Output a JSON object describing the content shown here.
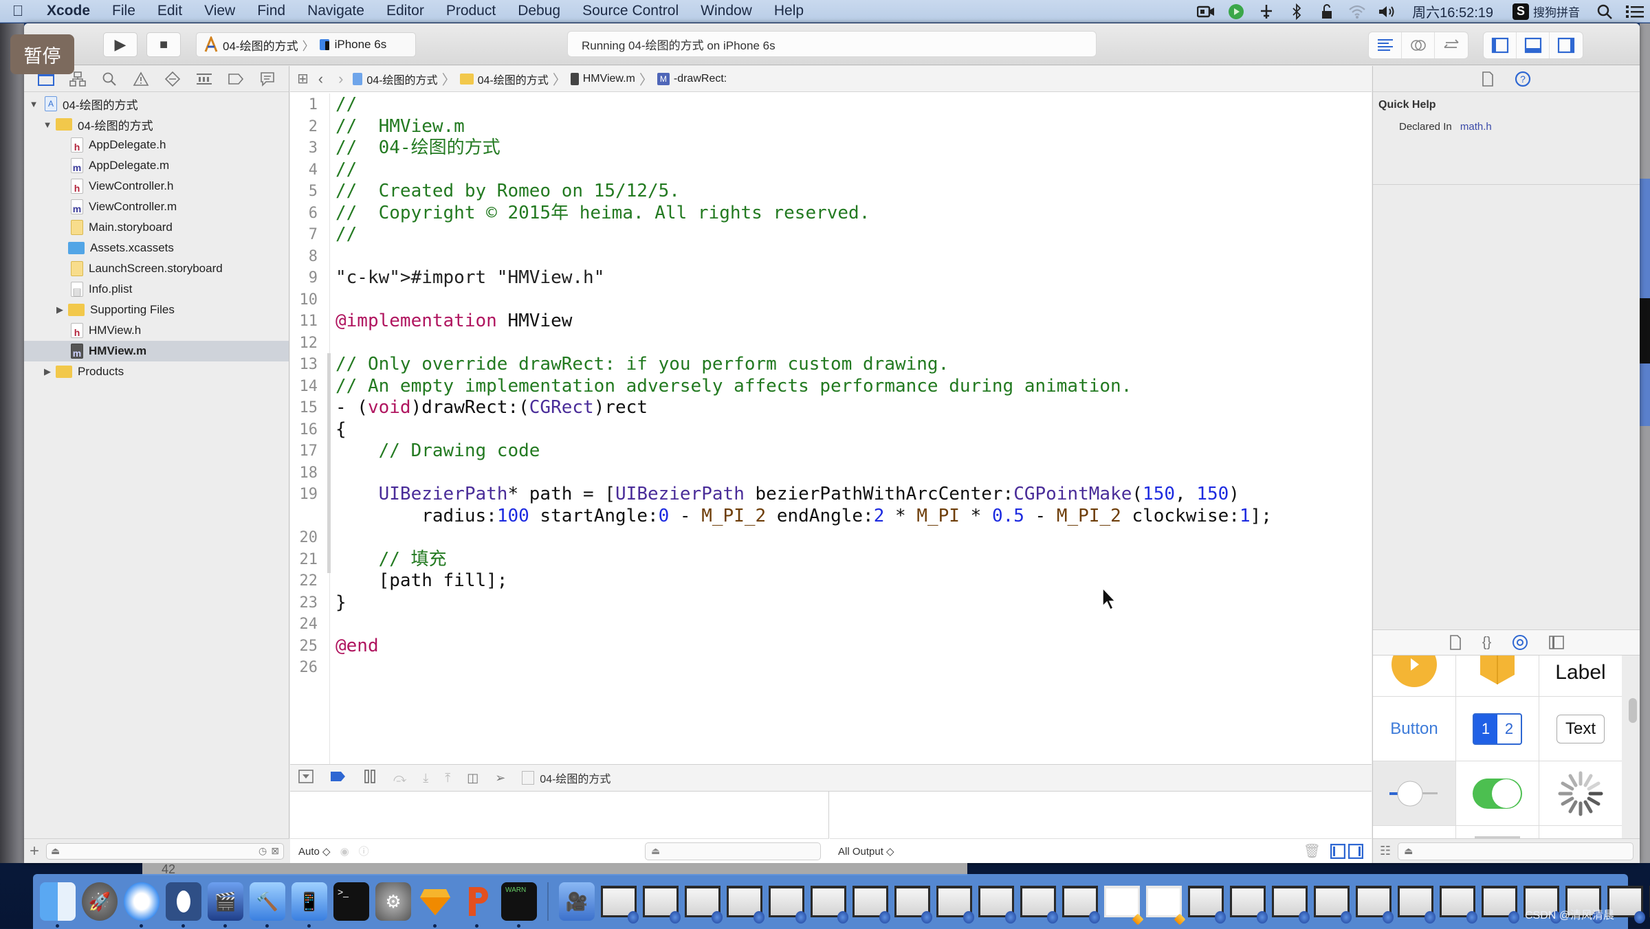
{
  "menubar": {
    "apple_icon": "apple-logo",
    "items": [
      "Xcode",
      "File",
      "Edit",
      "View",
      "Find",
      "Navigate",
      "Editor",
      "Product",
      "Debug",
      "Source Control",
      "Window",
      "Help"
    ],
    "status_icons": [
      "screen-record-icon",
      "play-circle-icon",
      "network-icon",
      "bluetooth-icon",
      "lock-icon",
      "wifi-icon",
      "volume-icon"
    ],
    "clock": "周六16:52:19",
    "ime_label": "搜狗拼音",
    "ime_logo": "S"
  },
  "overlay": {
    "pause_label": "暂停"
  },
  "toolbar": {
    "scheme_name": "04-绘图的方式",
    "device_name": "iPhone 6s",
    "activity_text": "Running 04-绘图的方式 on iPhone 6s",
    "run_icon": "▶",
    "stop_icon": "■"
  },
  "navigator": {
    "project": "04-绘图的方式",
    "group": "04-绘图的方式",
    "files": [
      {
        "name": "AppDelegate.h",
        "type": "h"
      },
      {
        "name": "AppDelegate.m",
        "type": "m"
      },
      {
        "name": "ViewController.h",
        "type": "h"
      },
      {
        "name": "ViewController.m",
        "type": "m"
      },
      {
        "name": "Main.storyboard",
        "type": "storyboard"
      },
      {
        "name": "Assets.xcassets",
        "type": "assets"
      },
      {
        "name": "LaunchScreen.storyboard",
        "type": "storyboard"
      },
      {
        "name": "Info.plist",
        "type": "plist"
      },
      {
        "name": "Supporting Files",
        "type": "folder"
      },
      {
        "name": "HMView.h",
        "type": "h"
      },
      {
        "name": "HMView.m",
        "type": "m",
        "selected": true
      }
    ],
    "products": "Products"
  },
  "jumpbar": {
    "crumbs": [
      "04-绘图的方式",
      "04-绘图的方式",
      "HMView.m",
      "-drawRect:"
    ]
  },
  "code": {
    "lines": [
      {
        "n": "1",
        "text": "//"
      },
      {
        "n": "2",
        "text": "//  HMView.m"
      },
      {
        "n": "3",
        "text": "//  04-绘图的方式"
      },
      {
        "n": "4",
        "text": "//"
      },
      {
        "n": "5",
        "text": "//  Created by Romeo on 15/12/5."
      },
      {
        "n": "6",
        "text": "//  Copyright © 2015年 heima. All rights reserved."
      },
      {
        "n": "7",
        "text": "//"
      },
      {
        "n": "8",
        "text": ""
      },
      {
        "n": "9",
        "text": "#import \"HMView.h\""
      },
      {
        "n": "10",
        "text": ""
      },
      {
        "n": "11",
        "text": "@implementation HMView"
      },
      {
        "n": "12",
        "text": ""
      },
      {
        "n": "13",
        "text": "// Only override drawRect: if you perform custom drawing."
      },
      {
        "n": "14",
        "text": "// An empty implementation adversely affects performance during animation."
      },
      {
        "n": "15",
        "text": "- (void)drawRect:(CGRect)rect"
      },
      {
        "n": "16",
        "text": "{"
      },
      {
        "n": "17",
        "text": "    // Drawing code"
      },
      {
        "n": "18",
        "text": ""
      },
      {
        "n": "19",
        "text": "    UIBezierPath* path = [UIBezierPath bezierPathWithArcCenter:CGPointMake(150, 150)"
      },
      {
        "n": "",
        "text": "        radius:100 startAngle:0 - M_PI_2 endAngle:2 * M_PI * 0.5 - M_PI_2 clockwise:1];"
      },
      {
        "n": "20",
        "text": ""
      },
      {
        "n": "21",
        "text": "    // 填充"
      },
      {
        "n": "22",
        "text": "    [path fill];"
      },
      {
        "n": "23",
        "text": "}"
      },
      {
        "n": "24",
        "text": ""
      },
      {
        "n": "25",
        "text": "@end"
      },
      {
        "n": "26",
        "text": ""
      }
    ]
  },
  "debugbar": {
    "target_label": "04-绘图的方式"
  },
  "console": {
    "variables_scope": "Auto ◇",
    "output_scope": "All Output ◇"
  },
  "inspector": {
    "quick_help_title": "Quick Help",
    "declared_in_label": "Declared In",
    "declared_in_value": "math.h"
  },
  "library": {
    "items": [
      {
        "name": "AV Player View Controller",
        "label": ""
      },
      {
        "name": "Object",
        "label": ""
      },
      {
        "name": "Label",
        "label": "Label"
      },
      {
        "name": "Button",
        "label": "Button"
      },
      {
        "name": "Segmented Control",
        "seg1": "1",
        "seg2": "2"
      },
      {
        "name": "Text Field",
        "label": "Text"
      },
      {
        "name": "Slider",
        "label": ""
      },
      {
        "name": "Switch",
        "label": ""
      },
      {
        "name": "Activity Indicator",
        "label": ""
      }
    ]
  },
  "background": {
    "line_number_hint": "42"
  },
  "dock": {
    "apps": [
      "Finder",
      "Launchpad",
      "Safari",
      "Mouse",
      "Photo Slideshow",
      "Xcode",
      "Simulator",
      "Terminal",
      "System Preferences",
      "Sketch",
      "PowerPoint",
      "Console"
    ],
    "watermark": "CSDN @清风清晨"
  },
  "colors": {
    "comment": "#237a21",
    "keyword": "#b0155f",
    "string": "#c41a16",
    "type": "#4a2d99",
    "number": "#1d2be0",
    "accent": "#2e67d2"
  }
}
